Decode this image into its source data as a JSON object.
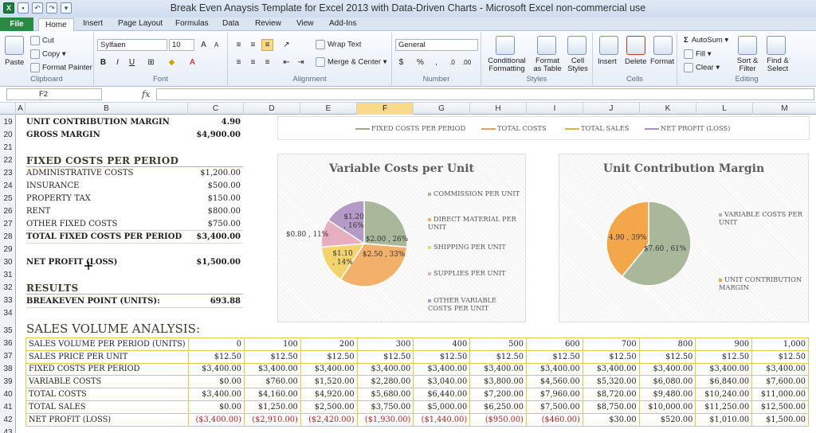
{
  "window": {
    "title": "Break Even Anaysis Template for Excel 2013 with Data-Driven Charts  -  Microsoft Excel non-commercial use"
  },
  "tabs": [
    "File",
    "Home",
    "Insert",
    "Page Layout",
    "Formulas",
    "Data",
    "Review",
    "View",
    "Add-Ins"
  ],
  "ribbon": {
    "clipboard": {
      "paste": "Paste",
      "cut": "Cut",
      "copy": "Copy",
      "format_painter": "Format Painter",
      "label": "Clipboard"
    },
    "font": {
      "name": "Sylfaen",
      "size": "10",
      "bold": "B",
      "italic": "I",
      "underline": "U",
      "label": "Font"
    },
    "alignment": {
      "wrap": "Wrap Text",
      "merge": "Merge & Center",
      "label": "Alignment"
    },
    "number": {
      "format": "General",
      "currency": "$",
      "percent": "%",
      "comma": ",",
      "label": "Number"
    },
    "styles": {
      "conditional": "Conditional Formatting",
      "format_table": "Format as Table",
      "cell_styles": "Cell Styles",
      "label": "Styles"
    },
    "cells": {
      "insert": "Insert",
      "delete": "Delete",
      "format": "Format",
      "label": "Cells"
    },
    "editing": {
      "autosum": "AutoSum",
      "fill": "Fill",
      "clear": "Clear",
      "sort": "Sort & Filter",
      "find": "Find & Select",
      "label": "Editing"
    }
  },
  "formula_bar": {
    "name_box": "F2",
    "fx": "fx",
    "value": ""
  },
  "columns": [
    "A",
    "B",
    "C",
    "D",
    "E",
    "F",
    "G",
    "H",
    "I",
    "J",
    "K",
    "L",
    "M"
  ],
  "rows": [
    "19",
    "20",
    "21",
    "22",
    "23",
    "24",
    "25",
    "26",
    "27",
    "28",
    "29",
    "30",
    "31",
    "32",
    "33",
    "34",
    "35",
    "36",
    "37",
    "38",
    "39",
    "40",
    "41",
    "42",
    "43"
  ],
  "sheet": {
    "ucm_label": "UNIT CONTRIBUTION MARGIN",
    "ucm_value": "4.90",
    "gm_label": "GROSS MARGIN",
    "gm_value": "$4,900.00",
    "fixed_header": "FIXED COSTS PER PERIOD",
    "fixed_items": [
      {
        "label": "ADMINISTRATIVE COSTS",
        "value": "$1,200.00"
      },
      {
        "label": "INSURANCE",
        "value": "$500.00"
      },
      {
        "label": "PROPERTY TAX",
        "value": "$150.00"
      },
      {
        "label": "RENT",
        "value": "$800.00"
      },
      {
        "label": "OTHER FIXED COSTS",
        "value": "$750.00"
      }
    ],
    "total_fixed_label": "TOTAL FIXED COSTS PER PERIOD",
    "total_fixed_value": "$3,400.00",
    "net_profit_label": "NET PROFIT (LOSS)",
    "net_profit_value": "$1,500.00",
    "results_header": "RESULTS",
    "breakeven_label": "BREAKEVEN POINT (UNITS):",
    "breakeven_value": "693.88",
    "sva_header": "SALES VOLUME ANALYSIS:"
  },
  "sales_table": [
    {
      "label": "SALES VOLUME PER PERIOD (UNITS)",
      "values": [
        "0",
        "100",
        "200",
        "300",
        "400",
        "500",
        "600",
        "700",
        "800",
        "900",
        "1,000"
      ]
    },
    {
      "label": "SALES PRICE PER UNIT",
      "values": [
        "$12.50",
        "$12.50",
        "$12.50",
        "$12.50",
        "$12.50",
        "$12.50",
        "$12.50",
        "$12.50",
        "$12.50",
        "$12.50",
        "$12.50"
      ]
    },
    {
      "label": "FIXED COSTS PER PERIOD",
      "values": [
        "$3,400.00",
        "$3,400.00",
        "$3,400.00",
        "$3,400.00",
        "$3,400.00",
        "$3,400.00",
        "$3,400.00",
        "$3,400.00",
        "$3,400.00",
        "$3,400.00",
        "$3,400.00"
      ]
    },
    {
      "label": "VARIABLE COSTS",
      "values": [
        "$0.00",
        "$760.00",
        "$1,520.00",
        "$2,280.00",
        "$3,040.00",
        "$3,800.00",
        "$4,560.00",
        "$5,320.00",
        "$6,080.00",
        "$6,840.00",
        "$7,600.00"
      ]
    },
    {
      "label": "TOTAL COSTS",
      "values": [
        "$3,400.00",
        "$4,160.00",
        "$4,920.00",
        "$5,680.00",
        "$6,440.00",
        "$7,200.00",
        "$7,960.00",
        "$8,720.00",
        "$9,480.00",
        "$10,240.00",
        "$11,000.00"
      ]
    },
    {
      "label": "TOTAL SALES",
      "values": [
        "$0.00",
        "$1,250.00",
        "$2,500.00",
        "$3,750.00",
        "$5,000.00",
        "$6,250.00",
        "$7,500.00",
        "$8,750.00",
        "$10,000.00",
        "$11,250.00",
        "$12,500.00"
      ]
    },
    {
      "label": "NET PROFIT (LOSS)",
      "values": [
        "($3,400.00)",
        "($2,910.00)",
        "($2,420.00)",
        "($1,930.00)",
        "($1,440.00)",
        "($950.00)",
        "($460.00)",
        "$30.00",
        "$520.00",
        "$1,010.00",
        "$1,500.00"
      ]
    }
  ],
  "line_legend": [
    "FIXED COSTS PER PERIOD",
    "TOTAL COSTS",
    "TOTAL SALES",
    "NET PROFIT (LOSS)"
  ],
  "line_legend_colors": [
    "#9aaa8c",
    "#f0a04b",
    "#e8b23a",
    "#b08cc0"
  ],
  "chart_data": [
    {
      "type": "pie",
      "title": "Variable Costs per Unit",
      "categories": [
        "COMMISSION PER UNIT",
        "DIRECT MATERIAL PER UNIT",
        "SHIPPING PER UNIT",
        "SUPPLIES PER UNIT",
        "OTHER VARIABLE COSTS PER UNIT"
      ],
      "values": [
        2.0,
        2.5,
        1.1,
        0.8,
        1.2
      ],
      "labels": [
        "$2.00 , 26%",
        "$2.50 , 33%",
        "$1.10 , 14%",
        "$0.80 , 11%",
        "$1.20 , 16%"
      ],
      "colors": [
        "#a9b89a",
        "#f3b06b",
        "#f2d36e",
        "#e6aec0",
        "#b59ac7"
      ],
      "legend": "right"
    },
    {
      "type": "pie",
      "title": "Unit Contribution Margin",
      "categories": [
        "VARIABLE COSTS PER UNIT",
        "UNIT CONTRIBUTION MARGIN"
      ],
      "values": [
        7.6,
        4.9
      ],
      "labels": [
        "$7.60 , 61%",
        "4.90 , 39%"
      ],
      "colors": [
        "#a9b89a",
        "#f3a64a"
      ],
      "legend": "right"
    }
  ]
}
